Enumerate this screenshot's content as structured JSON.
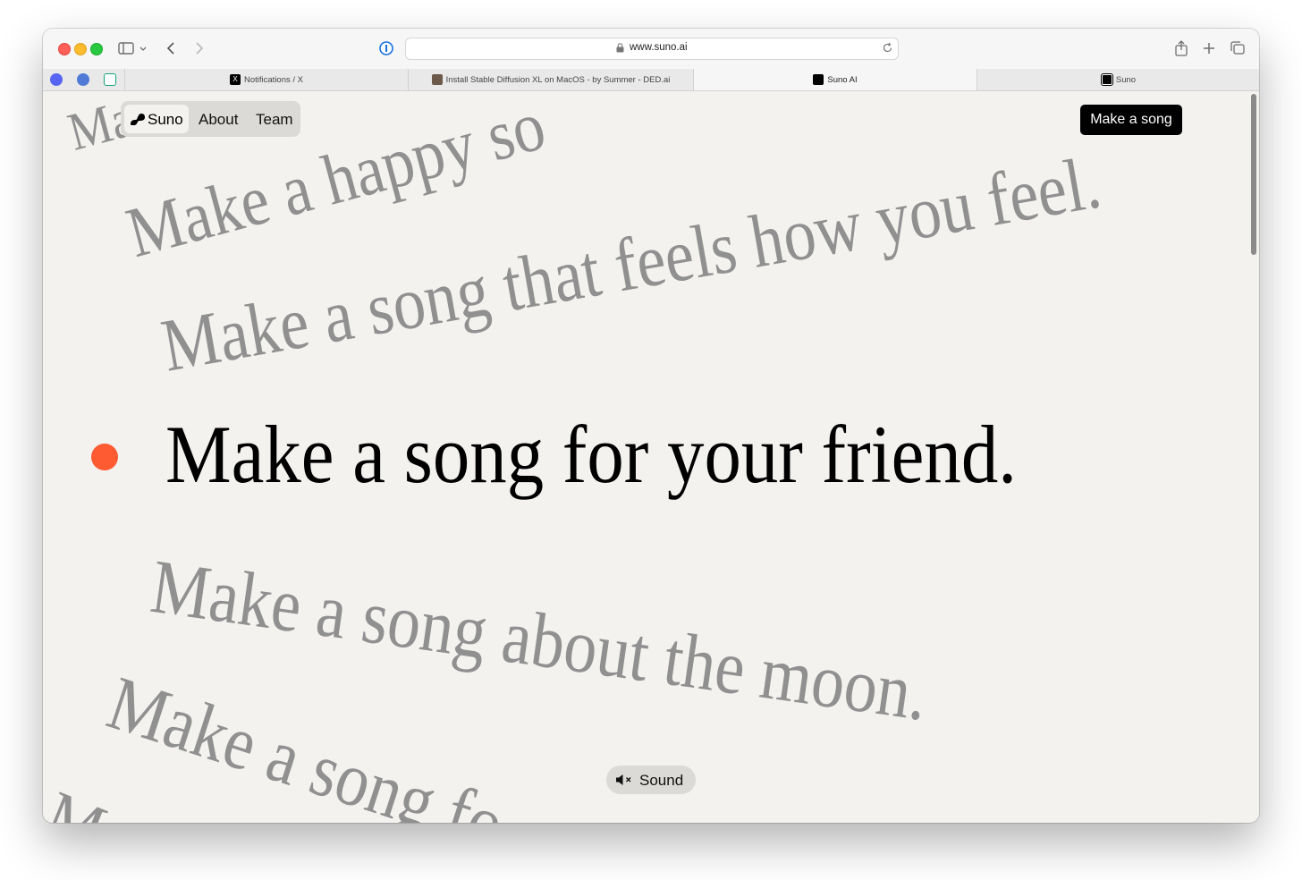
{
  "browser": {
    "url": "www.suno.ai",
    "tabs": [
      {
        "title": "Notifications / X",
        "favicon": "x-icon",
        "active": false
      },
      {
        "title": "Install Stable Diffusion XL on MacOS - by Summer - DED.ai",
        "favicon": "photo-icon",
        "active": false
      },
      {
        "title": "Suno AI",
        "favicon": "suno-icon",
        "active": true
      },
      {
        "title": "Suno",
        "favicon": "suno-icon",
        "active": false
      }
    ],
    "pinned_tabs": [
      "discord-icon",
      "sailboat-icon",
      "openai-icon"
    ]
  },
  "nav": {
    "logo": "Suno",
    "about": "About",
    "team": "Team"
  },
  "cta": {
    "label": "Make a song"
  },
  "prompts": {
    "top_partial": "Ma",
    "happy": "Make a happy so",
    "feel": "Make a song that feels how you feel.",
    "focus": "Make a song for your friend.",
    "moon": "Make a song about the moon.",
    "partial": "Make a song fo",
    "bottom_partial": "Ma"
  },
  "sound": {
    "label": "Sound",
    "icon": "speaker-muted-icon"
  },
  "colors": {
    "accent_dot": "#fe5b33",
    "background": "#f3f2ef",
    "faded_text": "#909090"
  }
}
